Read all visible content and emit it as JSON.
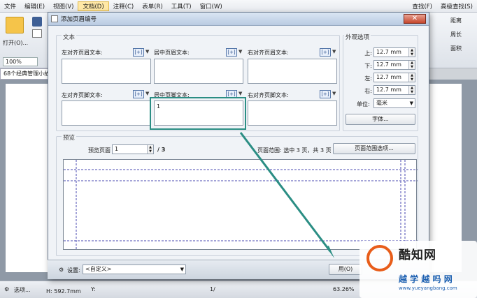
{
  "menubar": {
    "items": [
      "文件",
      "编辑(E)",
      "视图(V)",
      "文档(D)",
      "注释(C)",
      "表单(R)",
      "工具(T)",
      "窗口(W)"
    ],
    "right_items": [
      "查找(F)",
      "高级查找(S)"
    ]
  },
  "ribbon": {
    "open_label": "打开(O)...",
    "zoom": "100%",
    "right_tools": [
      "距离",
      "周长",
      "面积"
    ]
  },
  "doc_tab": "68个经典管理小故",
  "dialog": {
    "title": "添加页眉编号",
    "close": "✕",
    "text_group": "文本",
    "header_left": "左对齐页眉文本:",
    "header_center": "居中页眉文本:",
    "header_right": "右对齐页眉文本:",
    "footer_left": "左对齐页脚文本:",
    "footer_center": "居中页脚文本:",
    "footer_right": "右对齐页脚文本:",
    "footer_center_value": "1",
    "macro": "[+]",
    "appearance_group": "外观选项",
    "margins": [
      {
        "label": "上:",
        "value": "12.7 mm"
      },
      {
        "label": "下:",
        "value": "12.7 mm"
      },
      {
        "label": "左:",
        "value": "12.7 mm"
      },
      {
        "label": "右:",
        "value": "12.7 mm"
      }
    ],
    "unit_label": "单位:",
    "unit_value": "毫米",
    "font_button": "字体...",
    "preview_group": "预览",
    "preview_page_label": "预览页面",
    "preview_page_value": "1",
    "preview_total": "/ 3",
    "page_range_text": "页面范围: 选中 3 页，共 3 页",
    "page_range_button": "页面范围选项...",
    "settings_label": "设置:",
    "settings_value": "<自定义>",
    "bottom_right": "用(O)"
  },
  "status": {
    "options": "选项...",
    "size": "H: 592.7mm",
    "ylabel": "Y:",
    "page": "1/",
    "zoom": "63.26%"
  },
  "watermark": {
    "brand": "酷知网",
    "site": "越 学 越 吗 网",
    "url": "www.yueyangbang.com"
  },
  "colors": {
    "highlight": "#2b8e84",
    "arrow": "#2b8e84"
  }
}
